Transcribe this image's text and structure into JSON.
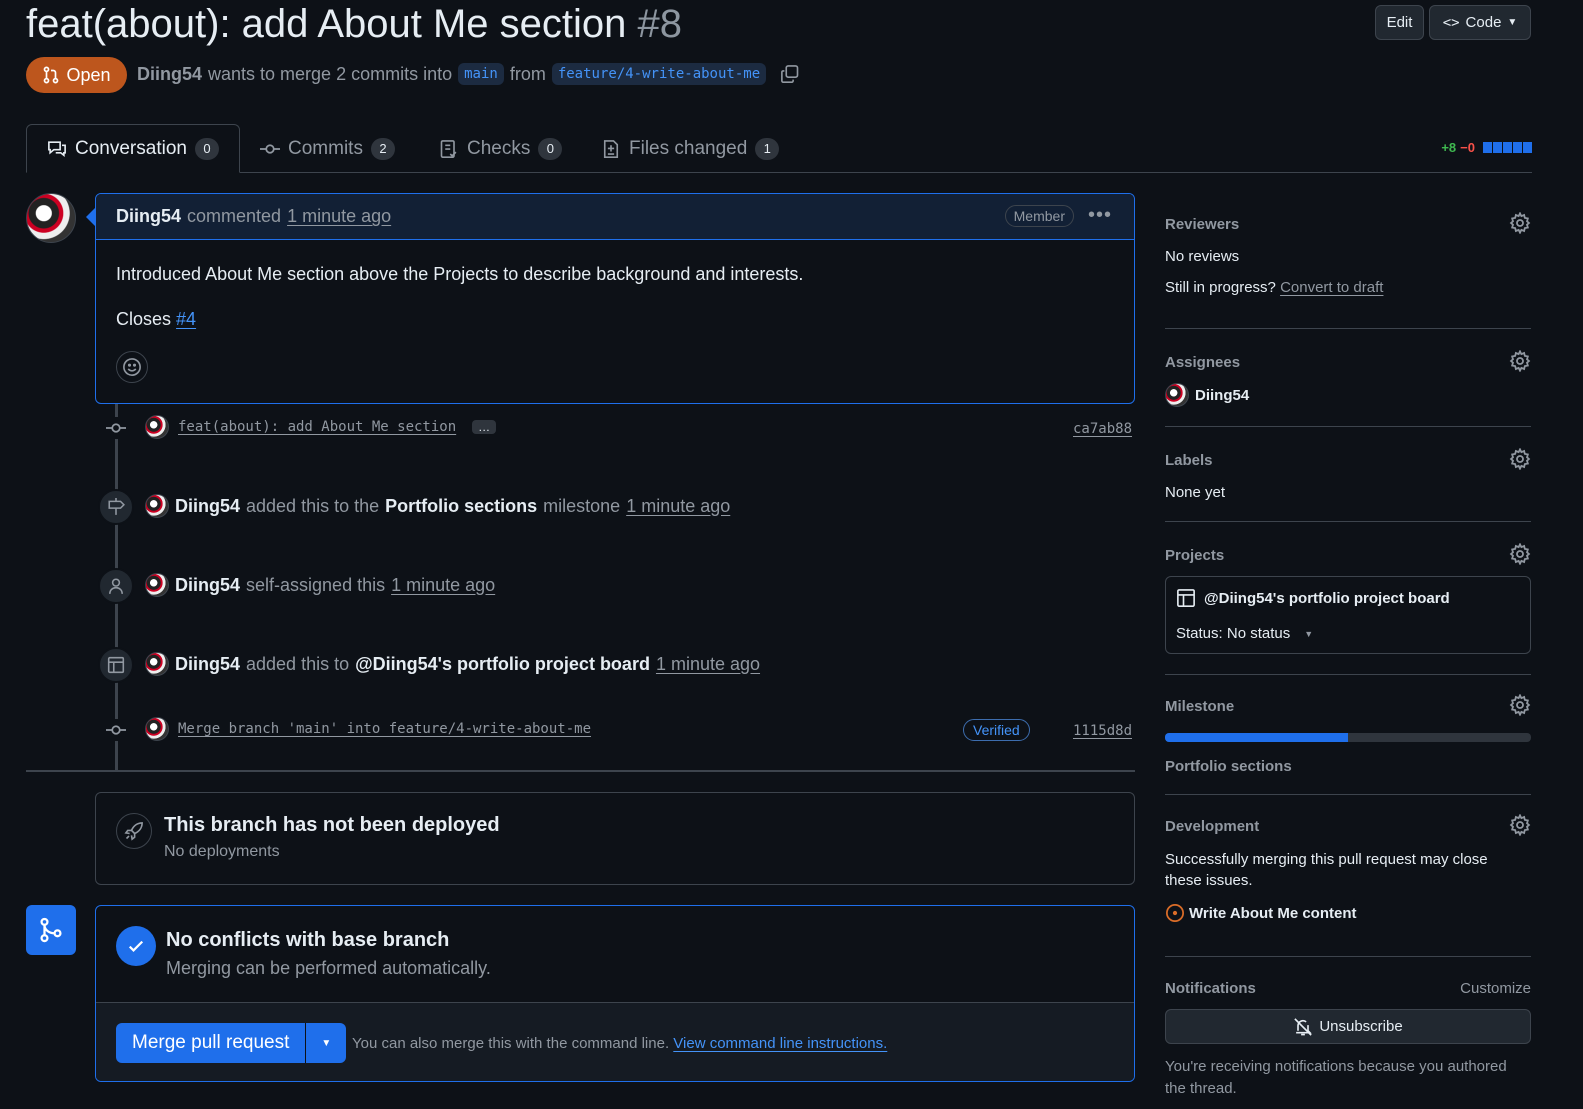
{
  "pr": {
    "title": "feat(about): add About Me section",
    "number": "#8",
    "state": "Open",
    "author": "Diing54",
    "merge_text": "wants to merge 2 commits into",
    "base_branch": "main",
    "from_text": "from",
    "head_branch": "feature/4-write-about-me"
  },
  "header_buttons": {
    "edit": "Edit",
    "code": "Code"
  },
  "tabs": [
    {
      "label": "Conversation",
      "count": "0"
    },
    {
      "label": "Commits",
      "count": "2"
    },
    {
      "label": "Checks",
      "count": "0"
    },
    {
      "label": "Files changed",
      "count": "1"
    }
  ],
  "diffstat": {
    "added": "+8",
    "removed": "−0"
  },
  "comment": {
    "author": "Diing54",
    "action": "commented",
    "time": "1 minute ago",
    "role": "Member",
    "body": "Introduced About Me section above the Projects to describe background and interests.",
    "closes_label": "Closes",
    "closes_ref": "#4"
  },
  "timeline": {
    "commit1": {
      "message": "feat(about): add About Me section",
      "ellipsis": "…",
      "sha": "ca7ab88"
    },
    "milestone": {
      "actor": "Diing54",
      "pre": "added this to the",
      "target": "Portfolio sections",
      "post": "milestone",
      "time": "1 minute ago"
    },
    "assign": {
      "actor": "Diing54",
      "text": "self-assigned this",
      "time": "1 minute ago"
    },
    "project": {
      "actor": "Diing54",
      "pre": "added this to",
      "target": "@Diing54's portfolio project board",
      "time": "1 minute ago"
    },
    "commit2": {
      "message": "Merge branch 'main' into feature/4-write-about-me",
      "badge": "Verified",
      "sha": "1115d8d"
    }
  },
  "deploy": {
    "title": "This branch has not been deployed",
    "subtitle": "No deployments"
  },
  "merge": {
    "title": "No conflicts with base branch",
    "subtitle": "Merging can be performed automatically.",
    "button": "Merge pull request",
    "hint": "You can also merge this with the command line.",
    "hint_link": "View command line instructions."
  },
  "sidebar": {
    "reviewers": {
      "title": "Reviewers",
      "value": "No reviews",
      "progress_q": "Still in progress?",
      "draft_link": "Convert to draft"
    },
    "assignees": {
      "title": "Assignees",
      "name": "Diing54"
    },
    "labels": {
      "title": "Labels",
      "value": "None yet"
    },
    "projects": {
      "title": "Projects",
      "board": "@Diing54's portfolio project board",
      "status": "Status: No status"
    },
    "milestone": {
      "title": "Milestone",
      "name": "Portfolio sections",
      "progress": 0.5
    },
    "development": {
      "title": "Development",
      "text": "Successfully merging this pull request may close these issues.",
      "issue": "Write About Me content"
    },
    "notifications": {
      "title": "Notifications",
      "customize": "Customize",
      "button": "Unsubscribe",
      "reason": "You're receiving notifications because you authored the thread."
    }
  },
  "colors": {
    "accent": "#1f6feb",
    "open": "#bd561d",
    "link": "#4493f8",
    "added": "#3fb950",
    "removed": "#f85149",
    "issue": "#db6d28"
  }
}
